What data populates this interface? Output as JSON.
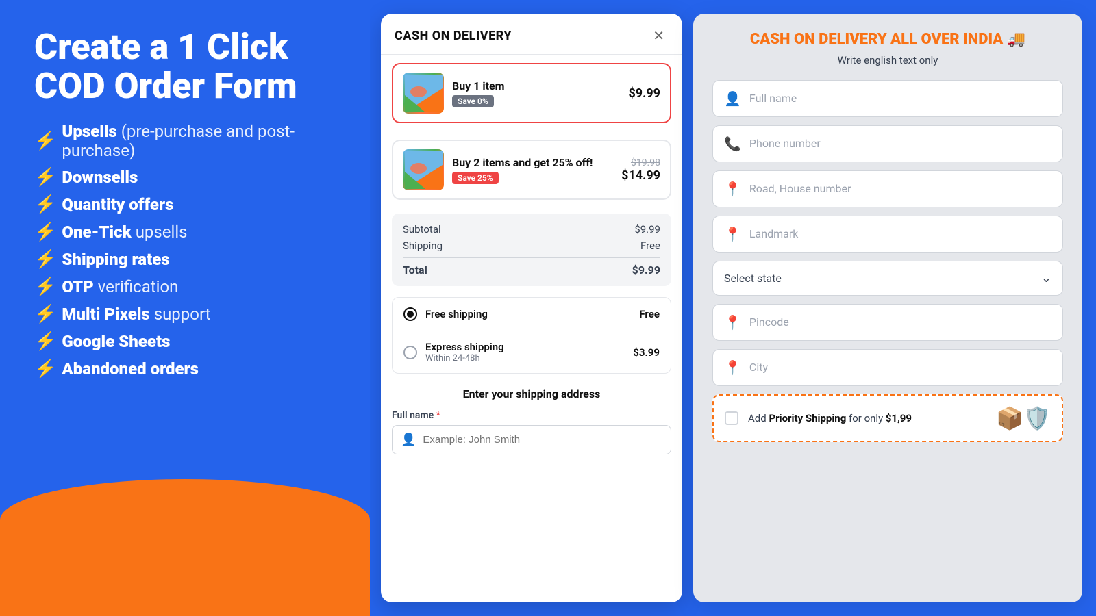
{
  "left": {
    "title": "Create a 1 Click COD Order Form",
    "features": [
      {
        "id": "upsells",
        "bolt": "⚡",
        "bold": "Upsells",
        "normal": "(pre-purchase and post-purchase)"
      },
      {
        "id": "downsells",
        "bolt": "⚡",
        "bold": "Downsells",
        "normal": ""
      },
      {
        "id": "quantity",
        "bolt": "⚡",
        "bold": "Quantity offers",
        "normal": ""
      },
      {
        "id": "onetick",
        "bolt": "⚡",
        "bold": "One-Tick",
        "normal": "upsells"
      },
      {
        "id": "shipping",
        "bolt": "⚡",
        "bold": "Shipping rates",
        "normal": ""
      },
      {
        "id": "otp",
        "bolt": "⚡",
        "bold": "OTP",
        "normal": "verification"
      },
      {
        "id": "pixels",
        "bolt": "⚡",
        "bold": "Multi Pixels",
        "normal": "support"
      },
      {
        "id": "sheets",
        "bolt": "⚡",
        "bold": "Google Sheets",
        "normal": ""
      },
      {
        "id": "abandoned",
        "bolt": "⚡",
        "bold": "Abandoned orders",
        "normal": ""
      }
    ]
  },
  "middle": {
    "header": {
      "title": "CASH ON DELIVERY",
      "close": "✕"
    },
    "products": [
      {
        "id": "p1",
        "name": "Buy 1 item",
        "badge": "Save 0%",
        "badge_color": "gray",
        "price_original": "",
        "price_final": "$9.99",
        "selected": true
      },
      {
        "id": "p2",
        "name": "Buy 2 items and get 25% off!",
        "badge": "Save 25%",
        "badge_color": "red",
        "price_original": "$19.98",
        "price_final": "$14.99",
        "selected": false
      }
    ],
    "summary": {
      "subtotal_label": "Subtotal",
      "subtotal_value": "$9.99",
      "shipping_label": "Shipping",
      "shipping_value": "Free",
      "total_label": "Total",
      "total_value": "$9.99"
    },
    "shipping_options": [
      {
        "id": "free",
        "name": "Free shipping",
        "sub": "",
        "price": "Free",
        "checked": true
      },
      {
        "id": "express",
        "name": "Express shipping",
        "sub": "Within 24-48h",
        "price": "$3.99",
        "checked": false
      }
    ],
    "address": {
      "section_title": "Enter your shipping address",
      "full_name_label": "Full name",
      "full_name_placeholder": "Example: John Smith"
    }
  },
  "right": {
    "title": "CASH ON DELIVERY ALL OVER INDIA 🚚",
    "subtitle": "Write english text only",
    "fields": [
      {
        "id": "full-name",
        "icon": "👤",
        "placeholder": "Full name"
      },
      {
        "id": "phone",
        "icon": "📞",
        "placeholder": "Phone number"
      },
      {
        "id": "road",
        "icon": "📍",
        "placeholder": "Road, House number"
      },
      {
        "id": "landmark",
        "icon": "📍",
        "placeholder": "Landmark"
      }
    ],
    "state_select": {
      "label": "Select state",
      "placeholder": "Select state"
    },
    "fields2": [
      {
        "id": "pincode",
        "icon": "📍",
        "placeholder": "Pincode"
      },
      {
        "id": "city",
        "icon": "📍",
        "placeholder": "City"
      }
    ],
    "priority": {
      "text_before": "Add ",
      "bold": "Priority Shipping",
      "text_after": " for only ",
      "price": "$1,99",
      "icon": "📦🛡️"
    }
  }
}
